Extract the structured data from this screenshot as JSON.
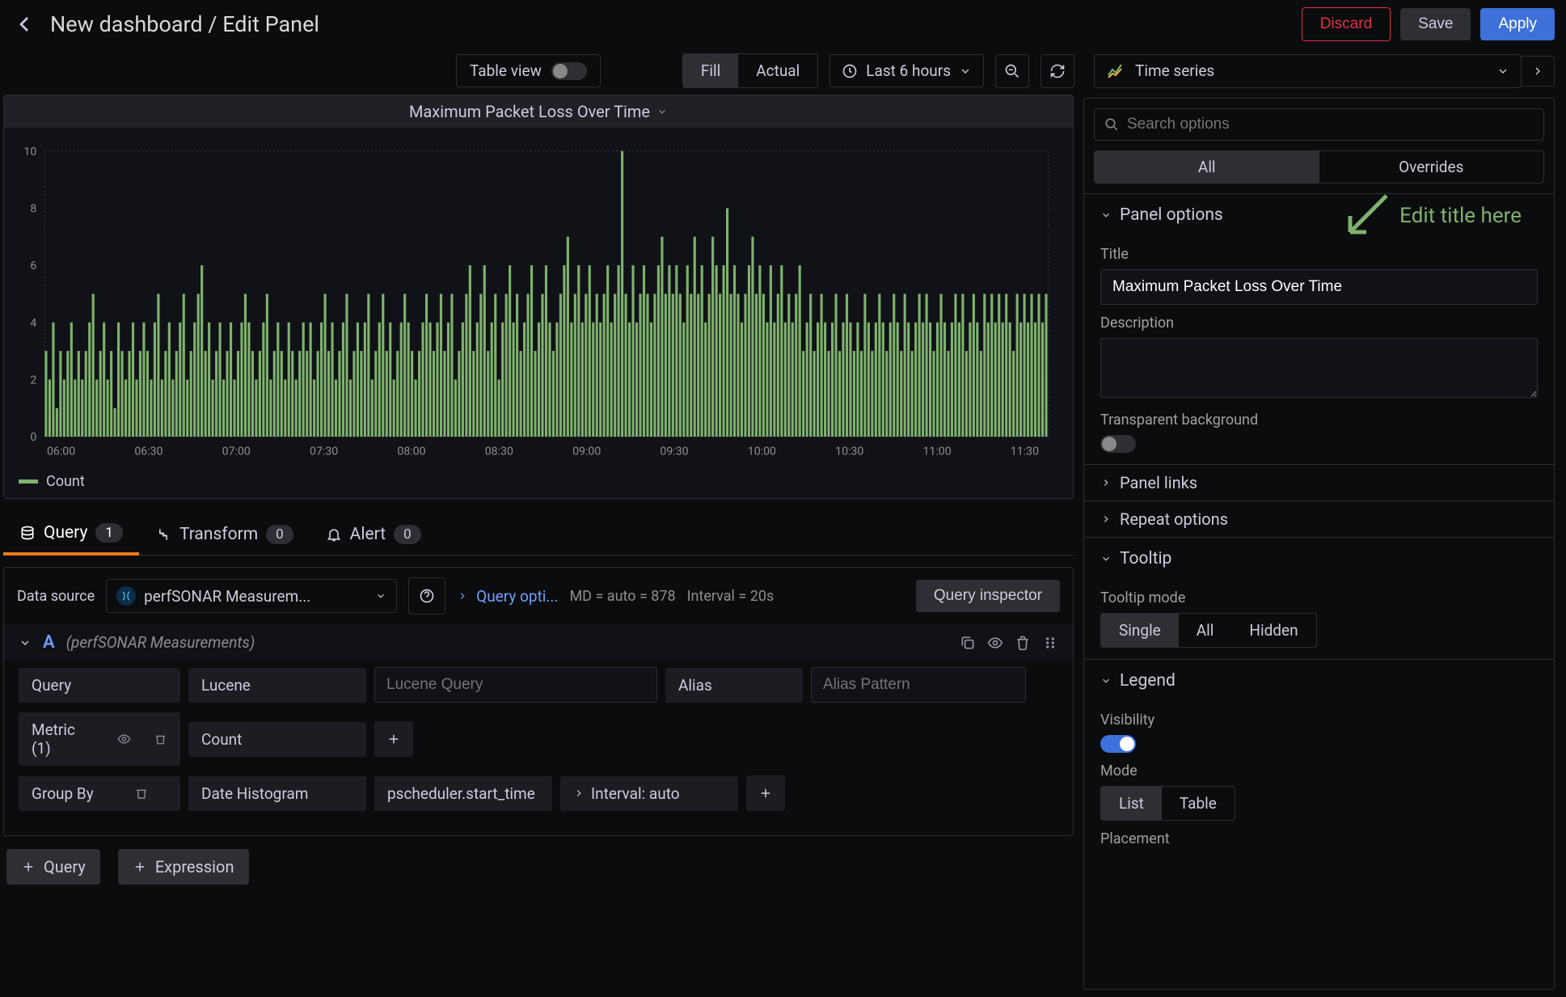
{
  "breadcrumb": "New dashboard / Edit Panel",
  "topbar": {
    "discard": "Discard",
    "save": "Save",
    "apply": "Apply"
  },
  "toolbar": {
    "table_view": "Table view",
    "fill": "Fill",
    "actual": "Actual",
    "time_range": "Last 6 hours",
    "viz_type": "Time series"
  },
  "panel": {
    "title": "Maximum Packet Loss Over Time",
    "legend": "Count"
  },
  "chart_data": {
    "type": "bar",
    "title": "Maximum Packet Loss Over Time",
    "xlabel": "",
    "ylabel": "",
    "ylim": [
      0,
      10
    ],
    "y_ticks": [
      0,
      2,
      4,
      6,
      8,
      10
    ],
    "annotation": "Edit title here",
    "x_ticks": [
      "06:00",
      "06:30",
      "07:00",
      "07:30",
      "08:00",
      "08:30",
      "09:00",
      "09:30",
      "10:00",
      "10:30",
      "11:00",
      "11:30"
    ],
    "series": [
      {
        "name": "Count",
        "color": "#7EB26D",
        "values": [
          3,
          2,
          4,
          1,
          3,
          2,
          3,
          4,
          2,
          3,
          2,
          3,
          4,
          5,
          2,
          3,
          4,
          2,
          3,
          1,
          4,
          3,
          2,
          3,
          4,
          2,
          3,
          4,
          3,
          2,
          4,
          5,
          2,
          3,
          4,
          2,
          3,
          4,
          5,
          2,
          3,
          4,
          5,
          6,
          3,
          4,
          2,
          3,
          4,
          2,
          3,
          4,
          2,
          3,
          4,
          5,
          4,
          3,
          2,
          3,
          4,
          5,
          2,
          3,
          4,
          3,
          2,
          4,
          3,
          2,
          3,
          4,
          3,
          4,
          2,
          3,
          4,
          5,
          3,
          4,
          2,
          3,
          4,
          5,
          2,
          3,
          4,
          3,
          4,
          5,
          2,
          3,
          4,
          5,
          3,
          4,
          2,
          3,
          4,
          5,
          4,
          3,
          2,
          3,
          4,
          5,
          4,
          3,
          4,
          5,
          3,
          4,
          5,
          2,
          3,
          4,
          5,
          6,
          3,
          4,
          5,
          6,
          3,
          4,
          5,
          2,
          4,
          5,
          6,
          4,
          5,
          3,
          4,
          5,
          6,
          3,
          4,
          5,
          6,
          4,
          3,
          4,
          5,
          6,
          7,
          4,
          5,
          6,
          4,
          5,
          6,
          4,
          5,
          4,
          5,
          6,
          4,
          5,
          6,
          10,
          5,
          4,
          6,
          4,
          5,
          6,
          5,
          4,
          5,
          6,
          7,
          5,
          6,
          5,
          6,
          5,
          4,
          6,
          5,
          7,
          5,
          6,
          4,
          5,
          7,
          6,
          5,
          6,
          8,
          5,
          6,
          5,
          4,
          5,
          6,
          7,
          5,
          6,
          5,
          4,
          6,
          4,
          5,
          6,
          4,
          5,
          4,
          5,
          6,
          3,
          4,
          5,
          3,
          4,
          5,
          4,
          3,
          4,
          5,
          3,
          4,
          5,
          4,
          3,
          4,
          3,
          5,
          4,
          3,
          4,
          5,
          4,
          3,
          4,
          5,
          4,
          3,
          5,
          4,
          3,
          4,
          5,
          4,
          5,
          4,
          3,
          4,
          5,
          4,
          3,
          4,
          5,
          4,
          5,
          3,
          4,
          5,
          4,
          3,
          5,
          4,
          5,
          4,
          5,
          4,
          5,
          4,
          3,
          5,
          4,
          5,
          4,
          5,
          4,
          5,
          4,
          5
        ]
      }
    ]
  },
  "tabs": {
    "query": "Query",
    "query_count": "1",
    "transform": "Transform",
    "transform_count": "0",
    "alert": "Alert",
    "alert_count": "0"
  },
  "query": {
    "ds_label": "Data source",
    "ds_name": "perfSONAR Measurem...",
    "query_options": "Query opti...",
    "md_label": "MD = auto = 878",
    "interval_label": "Interval = 20s",
    "inspector": "Query inspector",
    "letter": "A",
    "source_hint": "(perfSONAR Measurements)",
    "row_query_label": "Query",
    "row_query_type": "Lucene",
    "row_query_placeholder": "Lucene Query",
    "alias_label": "Alias",
    "alias_placeholder": "Alias Pattern",
    "metric_label": "Metric (1)",
    "metric_value": "Count",
    "groupby_label": "Group By",
    "groupby_value": "Date Histogram",
    "groupby_field": "pscheduler.start_time",
    "groupby_interval": "Interval: auto",
    "add_query": "Query",
    "add_expression": "Expression"
  },
  "options": {
    "search_placeholder": "Search options",
    "tab_all": "All",
    "tab_overrides": "Overrides",
    "panel_options": "Panel options",
    "title_label": "Title",
    "title_value": "Maximum Packet Loss Over Time",
    "description_label": "Description",
    "transparent_label": "Transparent background",
    "panel_links": "Panel links",
    "repeat_options": "Repeat options",
    "tooltip": "Tooltip",
    "tooltip_mode_label": "Tooltip mode",
    "tooltip_modes": [
      "Single",
      "All",
      "Hidden"
    ],
    "legend": "Legend",
    "visibility_label": "Visibility",
    "mode_label": "Mode",
    "legend_modes": [
      "List",
      "Table"
    ],
    "placement_label": "Placement"
  }
}
